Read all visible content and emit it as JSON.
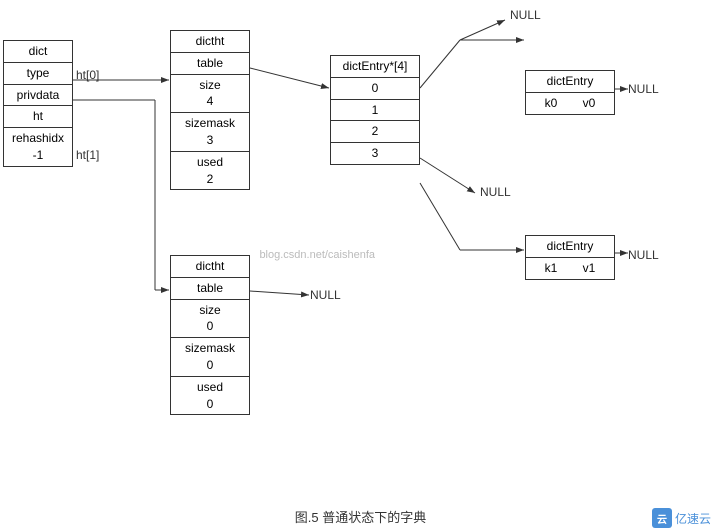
{
  "diagram": {
    "title": "图.5    普通状态下的字典",
    "watermark": "blog.csdn.net/caishenfa",
    "nullLabels": [
      "NULL",
      "NULL",
      "NULL",
      "NULL",
      "NULL"
    ],
    "ht0Label": "ht[0]",
    "ht1Label": "ht[1]",
    "dictBox": {
      "cells": [
        "dict",
        "type",
        "privdata",
        "ht",
        "rehashidx\n-1"
      ]
    },
    "dictht1Box": {
      "header": "dictht",
      "cells": [
        "table",
        "size\n4",
        "sizemask\n3",
        "used\n2"
      ]
    },
    "dictht2Box": {
      "header": "dictht",
      "cells": [
        "table",
        "size\n0",
        "sizemask\n0",
        "used\n0"
      ]
    },
    "dictEntryArrayBox": {
      "header": "dictEntry*[4]",
      "cells": [
        "0",
        "1",
        "2",
        "3"
      ]
    },
    "dictEntry1Box": {
      "header": "dictEntry",
      "cells": [
        "k0",
        "v0"
      ]
    },
    "dictEntry2Box": {
      "header": "dictEntry",
      "cells": [
        "k1",
        "v1"
      ]
    }
  },
  "footer": {
    "figureLabel": "图.5    普通状态下的字典",
    "logoText": "亿速云"
  }
}
